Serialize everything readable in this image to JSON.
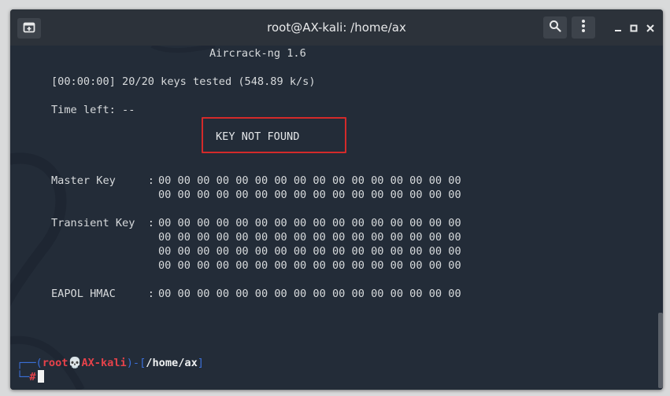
{
  "window": {
    "title": "root@AX-kali: /home/ax"
  },
  "icons": {
    "new_tab": "new-tab-icon",
    "search": "search-icon",
    "menu": "kebab-menu-icon",
    "minimize": "minimize-icon",
    "maximize": "maximize-icon",
    "close": "close-icon"
  },
  "terminal": {
    "header": "Aircrack-ng 1.6",
    "progress": "[00:00:00] 20/20 keys tested (548.89 k/s)",
    "time_left": "Time left: --",
    "result": "KEY NOT FOUND",
    "master_key": {
      "label": "Master Key     :",
      "rows": [
        "00 00 00 00 00 00 00 00 00 00 00 00 00 00 00 00",
        "00 00 00 00 00 00 00 00 00 00 00 00 00 00 00 00"
      ]
    },
    "transient_key": {
      "label": "Transient Key  :",
      "rows": [
        "00 00 00 00 00 00 00 00 00 00 00 00 00 00 00 00",
        "00 00 00 00 00 00 00 00 00 00 00 00 00 00 00 00",
        "00 00 00 00 00 00 00 00 00 00 00 00 00 00 00 00",
        "00 00 00 00 00 00 00 00 00 00 00 00 00 00 00 00"
      ]
    },
    "eapol_hmac": {
      "label": "EAPOL HMAC     :",
      "rows": [
        "00 00 00 00 00 00 00 00 00 00 00 00 00 00 00 00"
      ]
    },
    "prompt": {
      "corner_top": "┌──(",
      "user": "root",
      "skull": "💀",
      "host": "AX-kali",
      "sep": ")-[",
      "path": "/home/ax",
      "close": "]",
      "corner_bottom": "└─",
      "symbol": "#"
    }
  },
  "colors": {
    "terminal_bg": "#232c38",
    "titlebar_bg": "#2c323a",
    "highlight_box": "#d42a2a",
    "prompt_blue": "#3b6fd8",
    "prompt_red": "#e6424a"
  }
}
